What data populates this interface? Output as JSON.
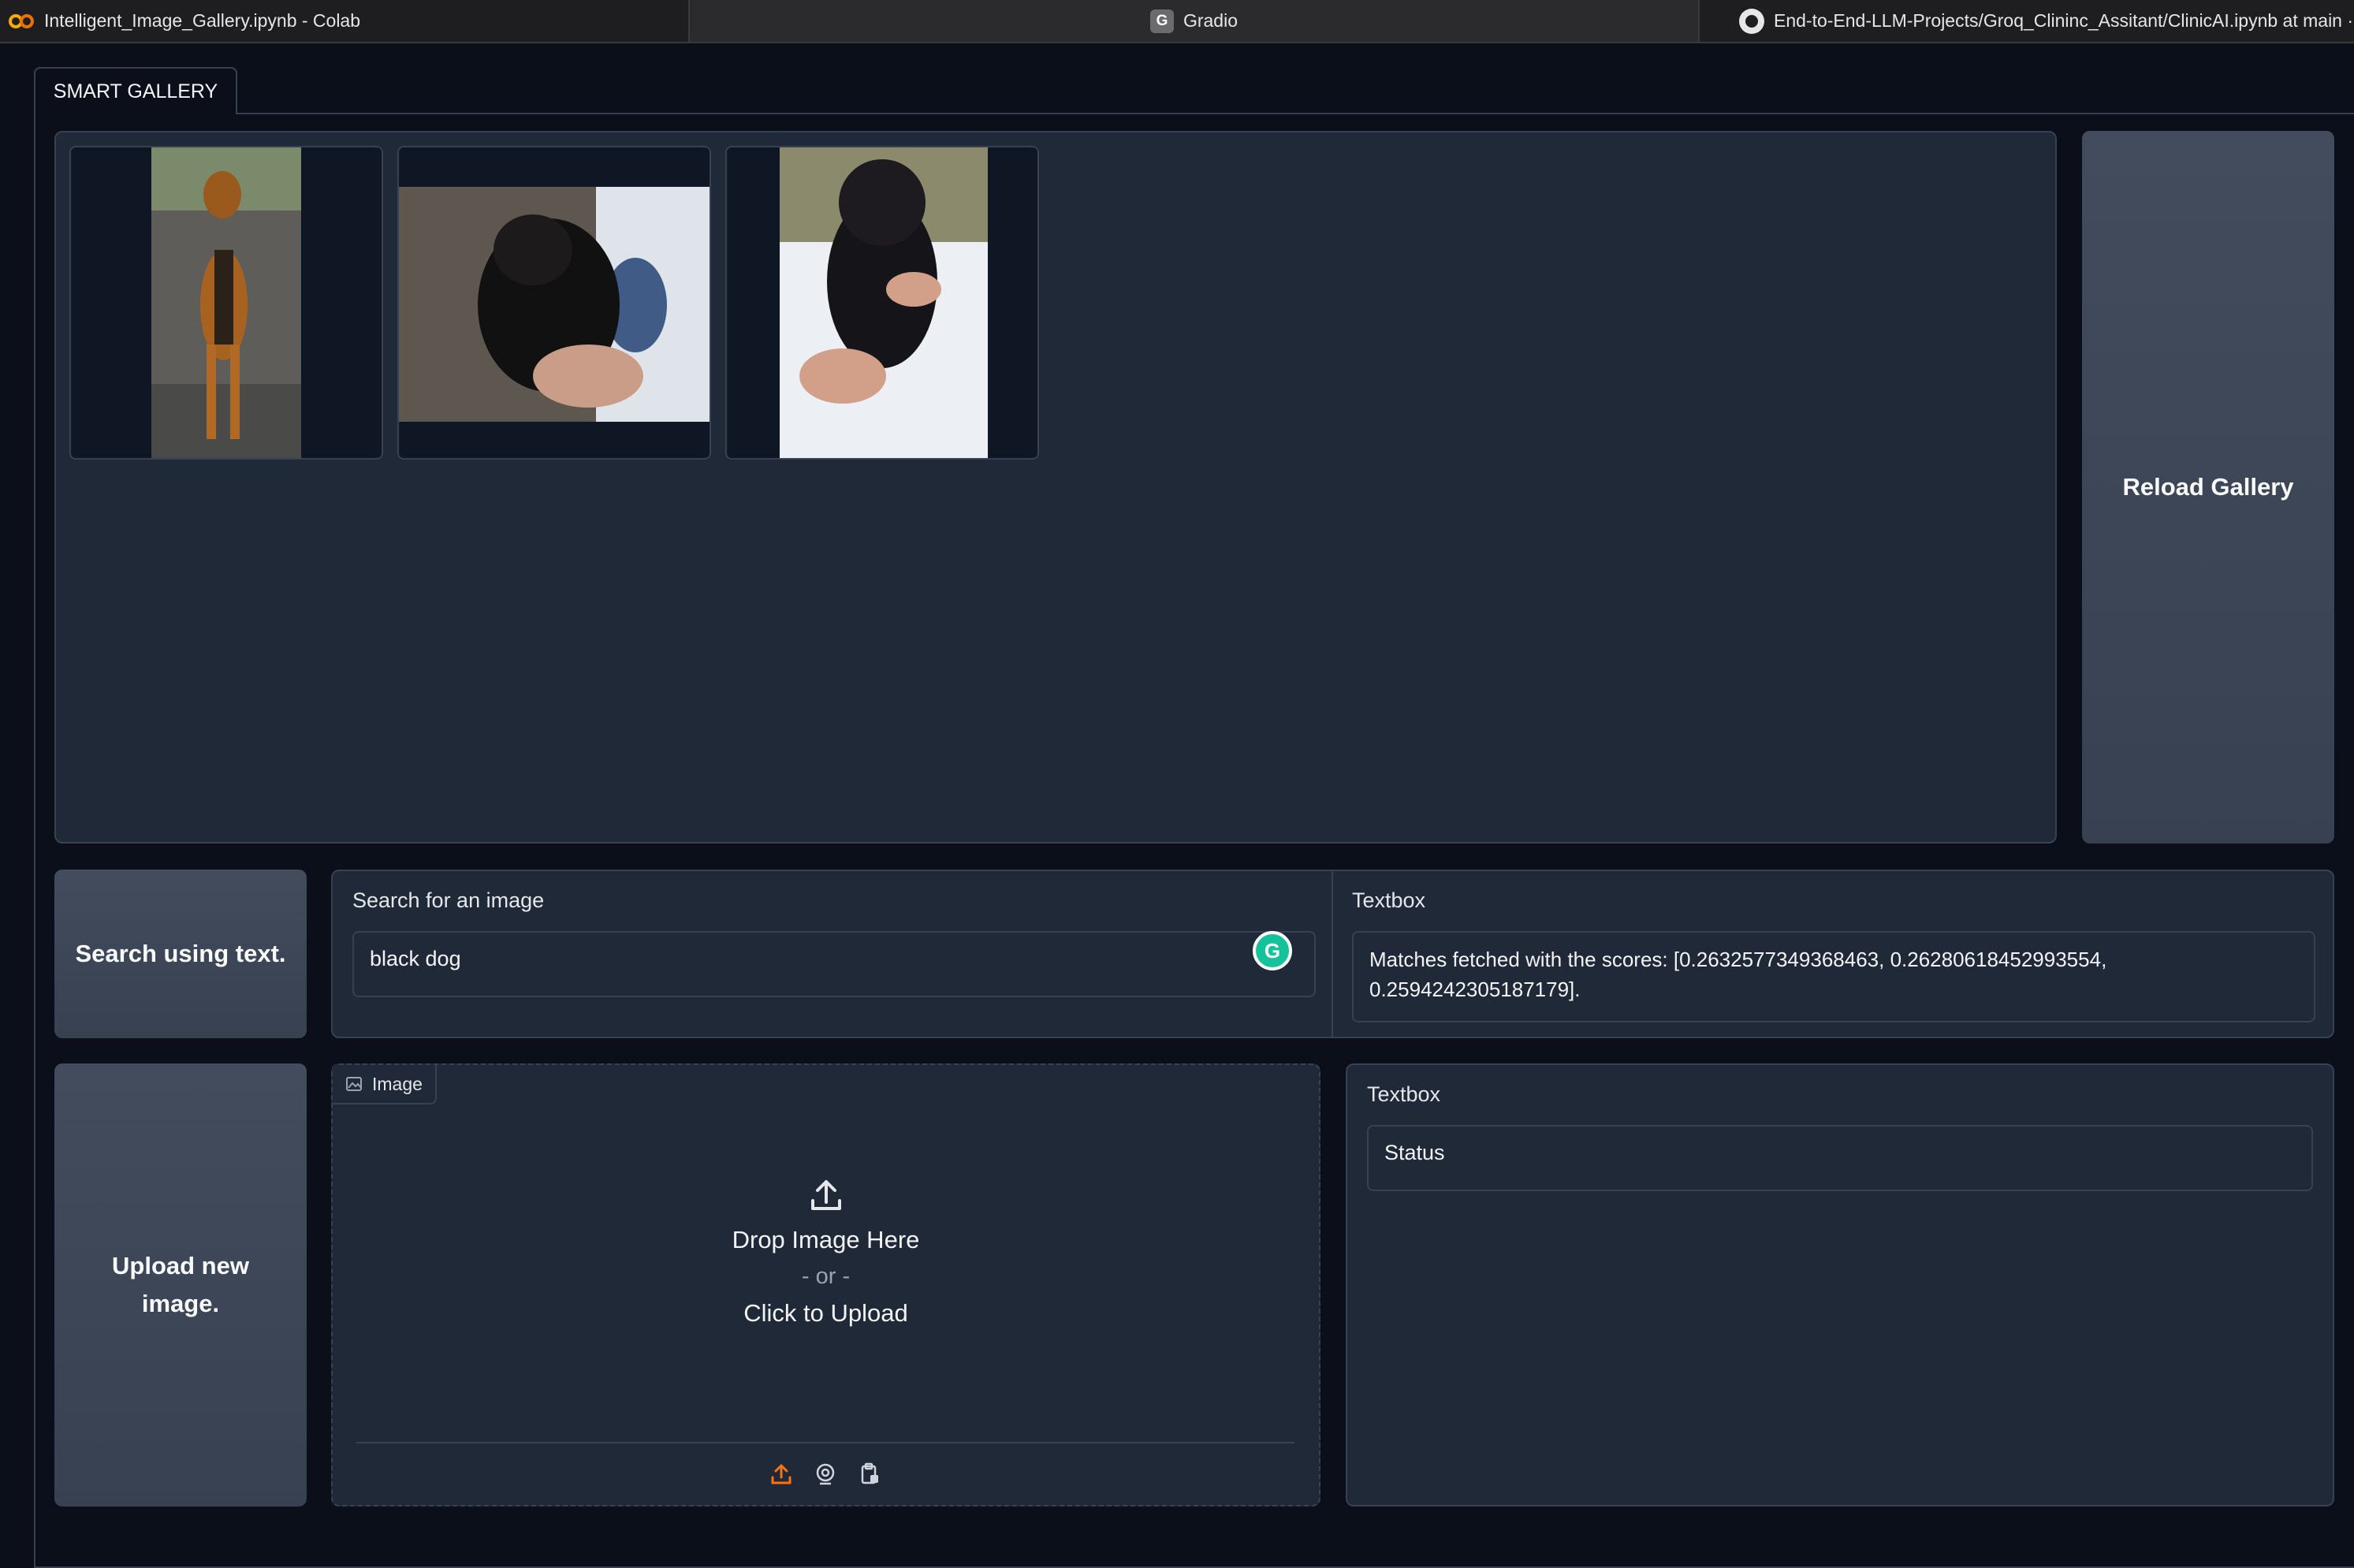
{
  "browser": {
    "tabs": [
      {
        "title": "Intelligent_Image_Gallery.ipynb - Colab",
        "icon": "colab-icon"
      },
      {
        "title": "Gradio",
        "icon": "gradio-icon"
      },
      {
        "title": "End-to-End-LLM-Projects/Groq_Clininc_Assitant/ClinicAI.ipynb at main ·",
        "icon": "github-icon"
      }
    ],
    "gradio_letter": "G"
  },
  "app": {
    "tabs": [
      {
        "label": "SMART GALLERY",
        "selected": true
      }
    ],
    "gallery": {
      "images": [
        {
          "alt": "brown and black dog standing"
        },
        {
          "alt": "black puppy held in hands"
        },
        {
          "alt": "black puppy held by person"
        }
      ]
    },
    "reload_button": "Reload Gallery",
    "search_button": "Search using text.",
    "search": {
      "label": "Search for an image",
      "value": "black dog"
    },
    "result": {
      "label": "Textbox",
      "value": "Matches fetched with the scores: [0.2632577349368463, 0.26280618452993554, 0.2594242305187179]."
    },
    "upload_button": "Upload new image.",
    "image_input": {
      "label": "Image",
      "drop_text": "Drop Image Here",
      "or_text": "- or -",
      "click_text": "Click to Upload"
    },
    "status": {
      "label": "Textbox",
      "value": "Status"
    }
  },
  "colors": {
    "accent": "#f97316",
    "background": "#0b0f19",
    "block": "#1f2937",
    "border": "#374151"
  }
}
